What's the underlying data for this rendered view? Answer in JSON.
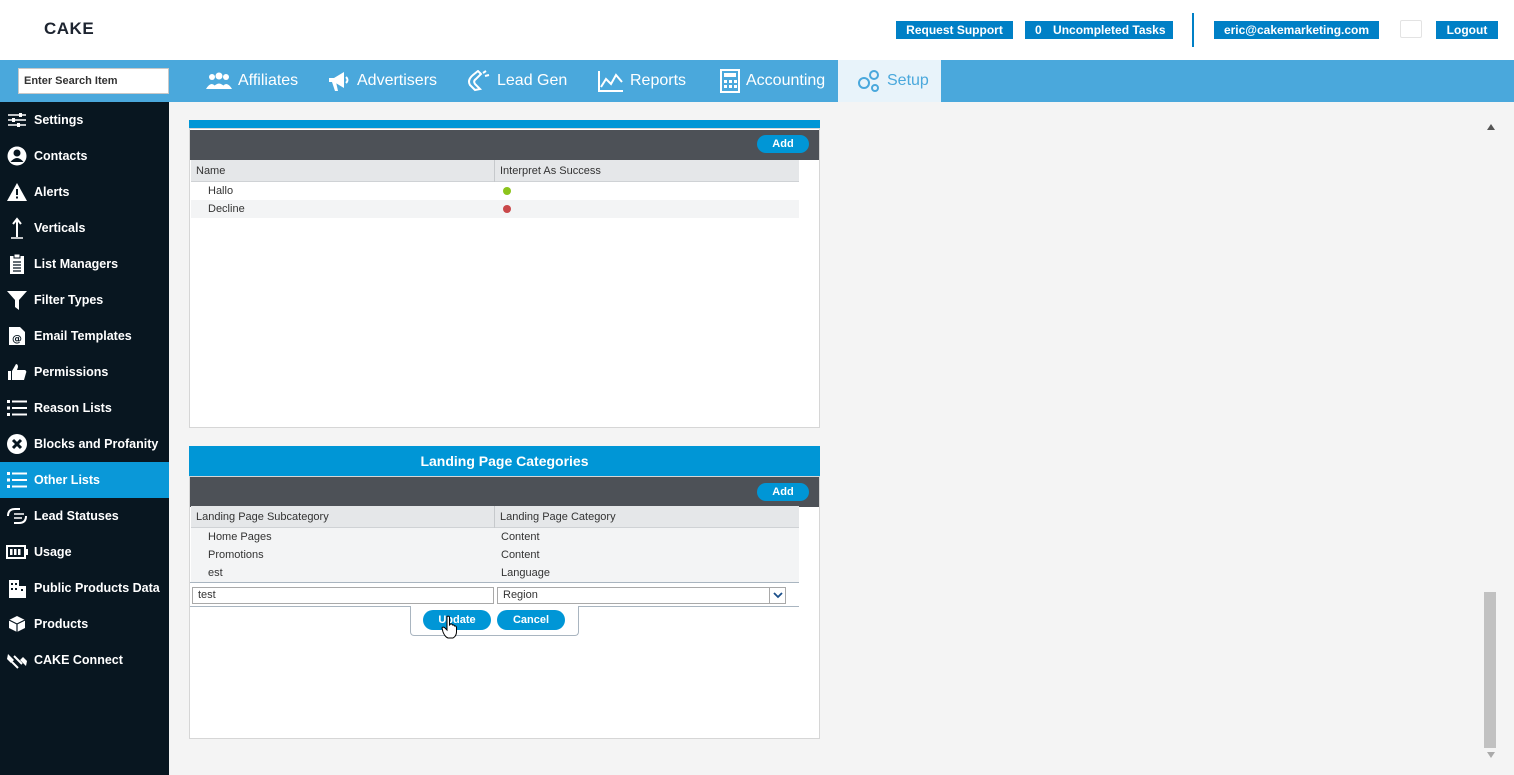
{
  "app": {
    "logo_text": "CAKE"
  },
  "header": {
    "request_support": "Request Support",
    "tasks_count": "0",
    "tasks_label": "Uncompleted Tasks",
    "user_email": "eric@cakemarketing.com",
    "logout": "Logout"
  },
  "search": {
    "placeholder": "Enter Search Item"
  },
  "nav": {
    "tabs": [
      {
        "label": "Affiliates",
        "icon": "users-icon"
      },
      {
        "label": "Advertisers",
        "icon": "megaphone-icon"
      },
      {
        "label": "Lead Gen",
        "icon": "magnet-icon"
      },
      {
        "label": "Reports",
        "icon": "chart-line-icon"
      },
      {
        "label": "Accounting",
        "icon": "calculator-icon"
      },
      {
        "label": "Setup",
        "icon": "gears-icon",
        "active": true
      }
    ]
  },
  "sidebar": {
    "items": [
      {
        "label": "Settings",
        "icon": "sliders-icon"
      },
      {
        "label": "Contacts",
        "icon": "person-icon"
      },
      {
        "label": "Alerts",
        "icon": "warning-icon"
      },
      {
        "label": "Verticals",
        "icon": "arrow-up-icon"
      },
      {
        "label": "List Managers",
        "icon": "clipboard-icon"
      },
      {
        "label": "Filter Types",
        "icon": "funnel-icon"
      },
      {
        "label": "Email Templates",
        "icon": "email-template-icon"
      },
      {
        "label": "Permissions",
        "icon": "thumbs-up-icon"
      },
      {
        "label": "Reason Lists",
        "icon": "list-icon"
      },
      {
        "label": "Blocks and Profanity",
        "icon": "x-circle-icon"
      },
      {
        "label": "Other Lists",
        "icon": "list-icon",
        "active": true
      },
      {
        "label": "Lead Statuses",
        "icon": "lead-status-icon"
      },
      {
        "label": "Usage",
        "icon": "battery-icon"
      },
      {
        "label": "Public Products Data",
        "icon": "building-icon"
      },
      {
        "label": "Products",
        "icon": "box-icon"
      },
      {
        "label": "CAKE Connect",
        "icon": "connect-icon"
      }
    ]
  },
  "panel1": {
    "add_label": "Add",
    "columns": [
      "Name",
      "Interpret As Success"
    ],
    "rows": [
      {
        "name": "Hallo",
        "success": true,
        "dot_color": "#8cc41c"
      },
      {
        "name": "Decline",
        "success": false,
        "dot_color": "#c9484a"
      }
    ]
  },
  "panel2": {
    "title": "Landing Page Categories",
    "add_label": "Add",
    "columns": [
      "Landing Page Subcategory",
      "Landing Page Category"
    ],
    "rows": [
      {
        "subcategory": "Home Pages",
        "category": "Content"
      },
      {
        "subcategory": "Promotions",
        "category": "Content"
      },
      {
        "subcategory": "est",
        "category": "Language"
      }
    ],
    "edit_row": {
      "subcategory_value": "test",
      "category_value": "Region"
    },
    "update_label": "Update",
    "cancel_label": "Cancel"
  },
  "colors": {
    "accent": "#0096d6",
    "nav": "#4aa8dc",
    "sidebar": "#081620",
    "active_side": "#0a98d8"
  }
}
